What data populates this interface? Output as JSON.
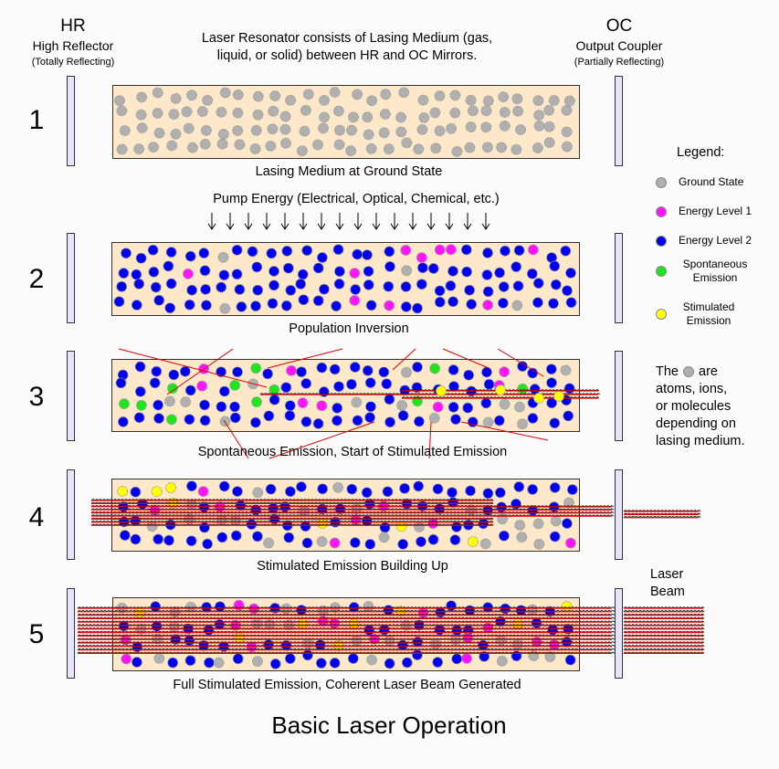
{
  "header": {
    "hr_title": "HR",
    "hr_name": "High Reflector",
    "hr_note": "(Totally Reflecting)",
    "oc_title": "OC",
    "oc_name": "Output Coupler",
    "oc_note": "(Partially Reflecting)",
    "intro_line1": "Laser Resonator consists of Lasing Medium (gas,",
    "intro_line2": "liquid, or solid) between HR and OC Mirrors."
  },
  "pump": {
    "label": "Pump Energy (Electrical, Optical, Chemical, etc.)",
    "arrow_count": 16,
    "arrow_glyph": "↓"
  },
  "stages": [
    {
      "number": "1",
      "caption": "Lasing Medium at Ground State",
      "state": "ground"
    },
    {
      "number": "2",
      "caption": "Population Inversion",
      "state": "inversion"
    },
    {
      "number": "3",
      "caption": "Spontaneous Emission, Start of Stimulated Emission",
      "state": "spontaneous"
    },
    {
      "number": "4",
      "caption": "Stimulated Emission Building Up",
      "state": "building"
    },
    {
      "number": "5",
      "caption": "Full Stimulated Emission, Coherent Laser Beam Generated",
      "state": "full"
    }
  ],
  "legend": {
    "title": "Legend:",
    "items": [
      {
        "label": "Ground State",
        "color": "#b0b0b0"
      },
      {
        "label": "Energy Level 1",
        "color": "#ff14ff"
      },
      {
        "label": "Energy Level 2",
        "color": "#0000f0"
      },
      {
        "label": "Spontaneous Emission",
        "color": "#1ee61e"
      },
      {
        "label": "Stimulated Emission",
        "color": "#ffff00"
      }
    ]
  },
  "note": {
    "part1": "The",
    "part2": "are",
    "line2": "atoms, ions,",
    "line3": "or molecules",
    "line4": "depending on",
    "line5": "lasing medium."
  },
  "laser_beam_label": {
    "line1": "Laser",
    "line2": "Beam"
  },
  "title": "Basic Laser Operation",
  "colors": {
    "tube_fill": "#fde9ca",
    "mirror_fill": "#e8e4fc",
    "beam_red": "#e00000",
    "ground": "#b0b0b0",
    "level1": "#ff14ff",
    "level2": "#0000f0",
    "spontaneous": "#1ee61e",
    "stimulated": "#ffff00"
  }
}
